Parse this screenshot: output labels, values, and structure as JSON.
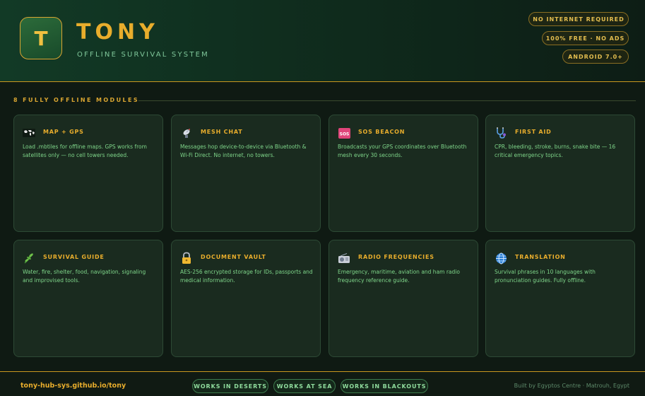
{
  "header": {
    "logo_letter": "T",
    "title": "TONY",
    "subtitle": "OFFLINE SURVIVAL SYSTEM",
    "badges": [
      "NO INTERNET REQUIRED",
      "100% FREE · NO ADS",
      "ANDROID 7.0+"
    ]
  },
  "section": {
    "label": "8 FULLY OFFLINE MODULES"
  },
  "modules": [
    {
      "icon": "world-map-icon",
      "title": "MAP + GPS",
      "desc": "Load .mbtiles for offline maps. GPS works from satellites only — no cell towers needed."
    },
    {
      "icon": "satellite-dish-icon",
      "title": "MESH CHAT",
      "desc": "Messages hop device-to-device via Bluetooth & Wi-Fi Direct. No internet, no towers."
    },
    {
      "icon": "sos-icon",
      "title": "SOS BEACON",
      "desc": "Broadcasts your GPS coordinates over Bluetooth mesh every 30 seconds."
    },
    {
      "icon": "stethoscope-icon",
      "title": "FIRST AID",
      "desc": "CPR, bleeding, stroke, burns, snake bite — 16 critical emergency topics."
    },
    {
      "icon": "herb-icon",
      "title": "SURVIVAL GUIDE",
      "desc": "Water, fire, shelter, food, navigation, signaling and improvised tools."
    },
    {
      "icon": "lock-icon",
      "title": "DOCUMENT VAULT",
      "desc": "AES-256 encrypted storage for IDs, passports and medical information."
    },
    {
      "icon": "radio-icon",
      "title": "RADIO FREQUENCIES",
      "desc": "Emergency, maritime, aviation and ham radio frequency reference guide."
    },
    {
      "icon": "globe-icon",
      "title": "TRANSLATION",
      "desc": "Survival phrases in 10 languages with pronunciation guides. Fully offline."
    }
  ],
  "footer": {
    "link": "tony-hub-sys.github.io/tony",
    "tags": [
      "WORKS IN DESERTS",
      "WORKS AT SEA",
      "WORKS IN BLACKOUTS"
    ],
    "credit": "Built by Egyptos Centre · Matrouh, Egypt"
  },
  "colors": {
    "accent": "#e8ad2c",
    "text_green": "#7fd68a",
    "background": "#0f1a13",
    "card_bg": "#1a2b1f"
  }
}
